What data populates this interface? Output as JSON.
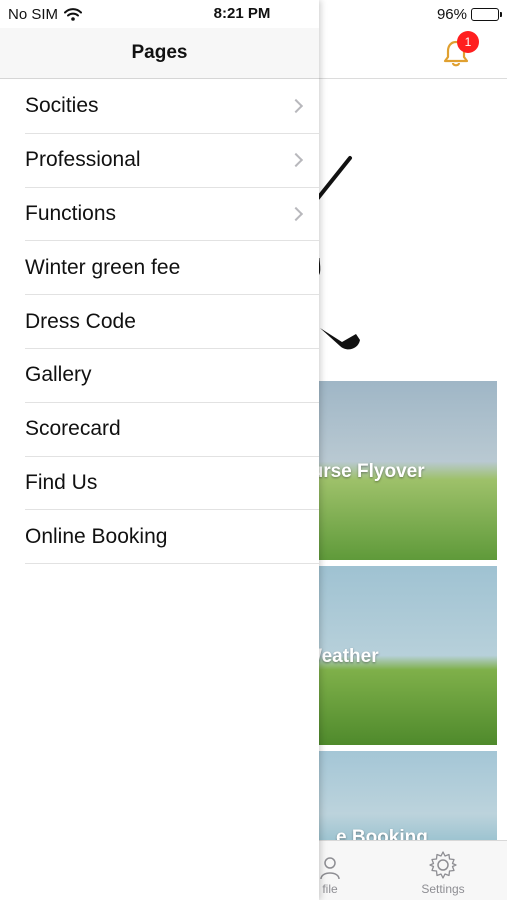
{
  "status_bar": {
    "carrier": "No SIM",
    "time": "8:21 PM",
    "battery": "96%",
    "battery_level": 0.96
  },
  "drawer": {
    "title": "Pages"
  },
  "menu": [
    {
      "label": "Socities",
      "chevron": true
    },
    {
      "label": "Professional",
      "chevron": true
    },
    {
      "label": "Functions",
      "chevron": true
    },
    {
      "label": "Winter green fee",
      "chevron": false
    },
    {
      "label": "Dress Code",
      "chevron": false
    },
    {
      "label": "Gallery",
      "chevron": false
    },
    {
      "label": "Scorecard",
      "chevron": false
    },
    {
      "label": "Find Us",
      "chevron": false
    },
    {
      "label": "Online Booking",
      "chevron": false
    }
  ],
  "notifications": {
    "badge_count": "1",
    "bell_color": "#e0a030",
    "badge_color": "#ff1f1f"
  },
  "tiles": [
    {
      "label": "ourse Flyover",
      "icon": "golf-course-photo"
    },
    {
      "label": "Weather",
      "icon": "golfer-photo"
    },
    {
      "label": "e Booking",
      "icon": "golfer-photo"
    }
  ],
  "tab_bar": {
    "profile_label": "file",
    "settings_label": "Settings"
  }
}
